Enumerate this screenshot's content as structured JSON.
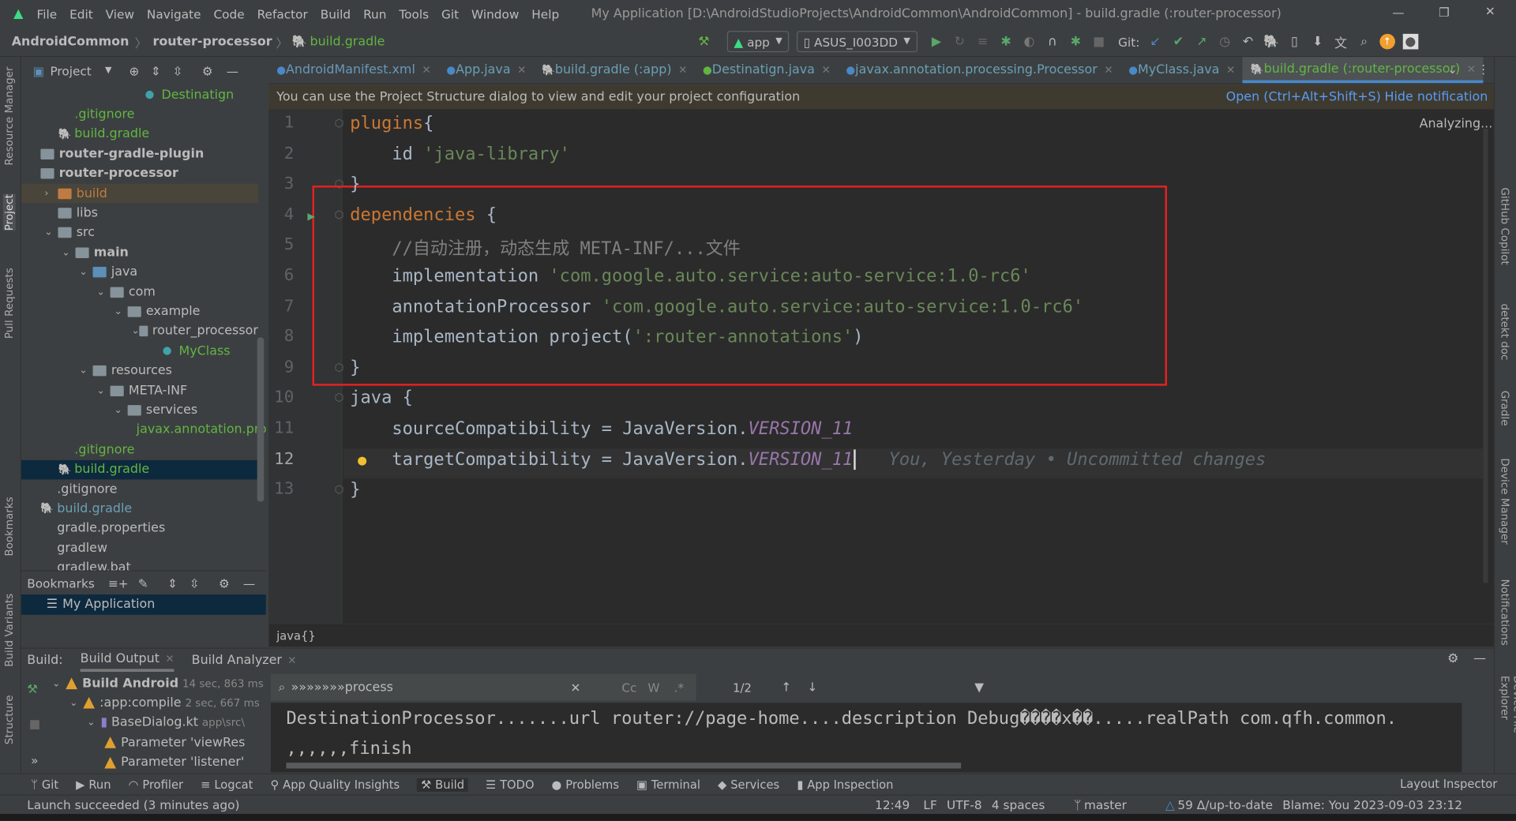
{
  "window": {
    "title": "My Application [D:\\AndroidStudioProjects\\AndroidCommon\\AndroidCommon] - build.gradle (:router-processor)"
  },
  "menu": [
    "File",
    "Edit",
    "View",
    "Navigate",
    "Code",
    "Refactor",
    "Build",
    "Run",
    "Tools",
    "Git",
    "Window",
    "Help"
  ],
  "navbar": {
    "breadcrumb": [
      "AndroidCommon",
      "router-processor",
      "build.gradle"
    ],
    "run_config": "app",
    "device": "ASUS_I003DD",
    "git_label": "Git:"
  },
  "project": {
    "title": "Project",
    "tree": [
      {
        "label": "Destinatign",
        "depth": 6,
        "kind": "annotation"
      },
      {
        "label": ".gitignore",
        "depth": 1,
        "kind": "file"
      },
      {
        "label": "build.gradle",
        "depth": 1,
        "kind": "gradle"
      },
      {
        "label": "router-gradle-plugin",
        "depth": 0,
        "kind": "module",
        "bold": true
      },
      {
        "label": "router-processor",
        "depth": 0,
        "kind": "module",
        "bold": true
      },
      {
        "label": "build",
        "depth": 1,
        "kind": "folder-orange",
        "chev": ">"
      },
      {
        "label": "libs",
        "depth": 1,
        "kind": "folder"
      },
      {
        "label": "src",
        "depth": 1,
        "kind": "folder",
        "chev": "v"
      },
      {
        "label": "main",
        "depth": 2,
        "kind": "folder",
        "chev": "v",
        "bold": true
      },
      {
        "label": "java",
        "depth": 3,
        "kind": "folder-blue",
        "chev": "v"
      },
      {
        "label": "com",
        "depth": 4,
        "kind": "folder",
        "chev": "v"
      },
      {
        "label": "example",
        "depth": 5,
        "kind": "folder",
        "chev": "v"
      },
      {
        "label": "router_processor",
        "depth": 6,
        "kind": "folder",
        "chev": "v"
      },
      {
        "label": "MyClass",
        "depth": 7,
        "kind": "class"
      },
      {
        "label": "resources",
        "depth": 3,
        "kind": "folder",
        "chev": "v"
      },
      {
        "label": "META-INF",
        "depth": 4,
        "kind": "folder",
        "chev": "v"
      },
      {
        "label": "services",
        "depth": 5,
        "kind": "folder",
        "chev": "v"
      },
      {
        "label": "javax.annotation.processing.Processor",
        "depth": 6,
        "kind": "file"
      },
      {
        "label": ".gitignore",
        "depth": 1,
        "kind": "file"
      },
      {
        "label": "build.gradle",
        "depth": 1,
        "kind": "gradle",
        "selected": true
      },
      {
        "label": ".gitignore",
        "depth": 0,
        "kind": "file"
      },
      {
        "label": "build.gradle",
        "depth": 0,
        "kind": "gradle"
      },
      {
        "label": "gradle.properties",
        "depth": 0,
        "kind": "file"
      },
      {
        "label": "gradlew",
        "depth": 0,
        "kind": "file"
      },
      {
        "label": "gradlew.bat",
        "depth": 0,
        "kind": "file"
      }
    ]
  },
  "bookmarks": {
    "title": "Bookmarks",
    "item": "My Application"
  },
  "tabs": [
    {
      "label": "AndroidManifest.xml",
      "color": "#6897bb"
    },
    {
      "label": "App.java",
      "color": "#6a9fb5"
    },
    {
      "label": "build.gradle (:app)",
      "color": "#6a9fb5"
    },
    {
      "label": "Destinatign.java",
      "color": "#6a9fb5"
    },
    {
      "label": "javax.annotation.processing.Processor",
      "color": "#6a9fb5"
    },
    {
      "label": "MyClass.java",
      "color": "#6a9fb5"
    },
    {
      "label": "build.gradle (:router-processor)",
      "color": "#62b543",
      "active": true
    }
  ],
  "notification": {
    "text": "You can use the Project Structure dialog to view and edit your project configuration",
    "open": "Open (Ctrl+Alt+Shift+S)",
    "hide": "Hide notification"
  },
  "editor": {
    "analyzing": "Analyzing...",
    "lines": [
      [
        [
          "kw",
          "plugins"
        ],
        [
          "",
          "{"
        ]
      ],
      [
        [
          "",
          "    id "
        ],
        [
          "str",
          "'java-library'"
        ]
      ],
      [
        [
          "",
          "}"
        ]
      ],
      [
        [
          "kw",
          "dependencies"
        ],
        [
          "",
          " {"
        ]
      ],
      [
        [
          "cm",
          "    //自动注册，动态生成 META-INF/...文件"
        ]
      ],
      [
        [
          "",
          "    implementation "
        ],
        [
          "str",
          "'com.google.auto.service:auto-service:1.0-rc6'"
        ]
      ],
      [
        [
          "",
          "    annotationProcessor "
        ],
        [
          "str",
          "'com.google.auto.service:auto-service:1.0-rc6'"
        ]
      ],
      [
        [
          "",
          "    implementation project("
        ],
        [
          "str",
          "':router-annotations'"
        ],
        [
          "",
          ")"
        ]
      ],
      [
        [
          "",
          "}"
        ]
      ],
      [
        [
          "",
          "java {"
        ]
      ],
      [
        [
          "",
          "    sourceCompatibility = JavaVersion."
        ],
        [
          "it",
          "VERSION_11"
        ]
      ],
      [
        [
          "",
          "    targetCompatibility = JavaVersion."
        ],
        [
          "it",
          "VERSION_11"
        ]
      ],
      [
        [
          "",
          "}"
        ]
      ]
    ],
    "blame": "You, Yesterday • Uncommitted changes",
    "breadcrumb": "java{}"
  },
  "build": {
    "label": "Build:",
    "tabs": [
      "Build Output",
      "Build Analyzer"
    ],
    "tree": [
      {
        "label": "Build Android",
        "time": "14 sec, 863 ms",
        "bold": true
      },
      {
        "label": ":app:compile",
        "time": "2 sec, 667 ms"
      },
      {
        "label": "BaseDialog.kt",
        "time": "app\\src\\"
      },
      {
        "label": "Parameter 'viewRes"
      },
      {
        "label": "Parameter 'listener'"
      }
    ],
    "search": "»»»»»»»process",
    "match": "1/2",
    "output": [
      "DestinationProcessor.......url router://page-home....description Debug����x��.....realPath com.qfh.common.",
      ",,,,,,finish"
    ]
  },
  "bottom_tools": [
    "Git",
    "Run",
    "Profiler",
    "Logcat",
    "App Quality Insights",
    "Build",
    "TODO",
    "Problems",
    "Terminal",
    "Services",
    "App Inspection"
  ],
  "layout_inspector": "Layout Inspector",
  "status": {
    "message": "Launch succeeded (3 minutes ago)",
    "position": "12:49",
    "line_sep": "LF",
    "encoding": "UTF-8",
    "indent": "4 spaces",
    "branch": "master",
    "git_status": "59 Δ/up-to-date",
    "blame": "Blame: You 2023-09-03 23:12"
  },
  "left_strip": [
    "Resource Manager",
    "Project",
    "Pull Requests",
    "Bookmarks",
    "Build Variants",
    "Structure"
  ],
  "right_strip": [
    "GitHub Copilot",
    "detekt doc",
    "Gradle",
    "Device Manager",
    "Notifications",
    "Device File Explorer"
  ],
  "colors": {
    "highlight_box": "#e52222",
    "accent": "#4a88c7",
    "selection": "#0d293e"
  }
}
